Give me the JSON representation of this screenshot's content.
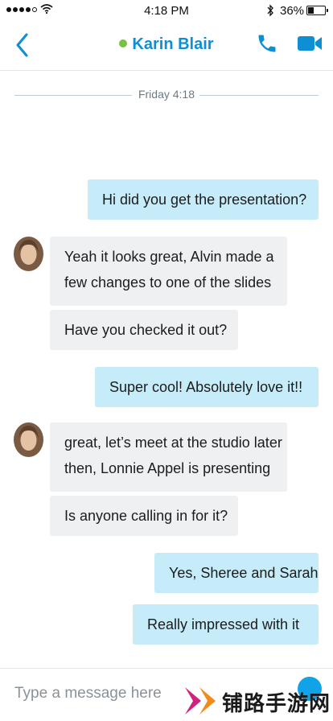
{
  "status_bar": {
    "time": "4:18 PM",
    "battery_percent": "36%",
    "battery_level": 0.36,
    "signal_bars": 4
  },
  "header": {
    "contact_name": "Karin Blair",
    "presence_color": "#7ac13f",
    "accent_color": "#0f8fd3"
  },
  "date_divider": "Friday 4:18",
  "messages": [
    {
      "direction": "out",
      "text": "Hi did you get the presentation?"
    },
    {
      "direction": "in",
      "lines": [
        "Yeah it looks great, Alvin made a",
        "few changes to one of the slides"
      ]
    },
    {
      "direction": "in",
      "text": "Have you checked it out?"
    },
    {
      "direction": "out",
      "text": "Super cool! Absolutely love it!!"
    },
    {
      "direction": "in",
      "lines": [
        "great, let’s meet at the studio later",
        "then, Lonnie Appel is presenting"
      ]
    },
    {
      "direction": "in",
      "text": "Is anyone calling in for it?"
    },
    {
      "direction": "out",
      "text": "Yes, Sheree and Sarah"
    },
    {
      "direction": "out",
      "text": "Really impressed with it"
    }
  ],
  "composer": {
    "placeholder": "Type a message here"
  },
  "watermark": {
    "text": "铺路手游网"
  }
}
